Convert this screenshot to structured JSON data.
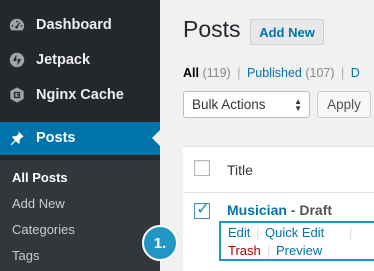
{
  "sidebar": {
    "menu": [
      {
        "label": "Dashboard",
        "icon": "dashboard-icon"
      },
      {
        "label": "Jetpack",
        "icon": "jetpack-icon"
      },
      {
        "label": "Nginx Cache",
        "icon": "nginx-cache-icon"
      },
      {
        "label": "Posts",
        "icon": "pin-icon",
        "current": true
      }
    ],
    "submenu": [
      "All Posts",
      "Add New",
      "Categories",
      "Tags"
    ]
  },
  "main": {
    "title": "Posts",
    "add_new": "Add New",
    "filters": {
      "all_label": "All",
      "all_count": "(119)",
      "separator": "|",
      "published_label": "Published",
      "published_count": "(107)",
      "separator2": "|",
      "next_initial": "D"
    },
    "bulk_actions": {
      "selected": "Bulk Actions",
      "apply": "Apply"
    },
    "table": {
      "column_title": "Title",
      "rows": [
        {
          "title": "Musician",
          "state": " - Draft",
          "checked": true,
          "actions": {
            "edit": "Edit",
            "quick_edit": "Quick Edit",
            "trash": "Trash",
            "preview": "Preview",
            "separator": "|"
          }
        }
      ]
    }
  },
  "callout": {
    "label": "1."
  },
  "colors": {
    "sidebar_bg": "#23282d",
    "submenu_bg": "#32373c",
    "accent": "#0073aa",
    "callout": "#2196c4",
    "trash": "#aa0000"
  }
}
